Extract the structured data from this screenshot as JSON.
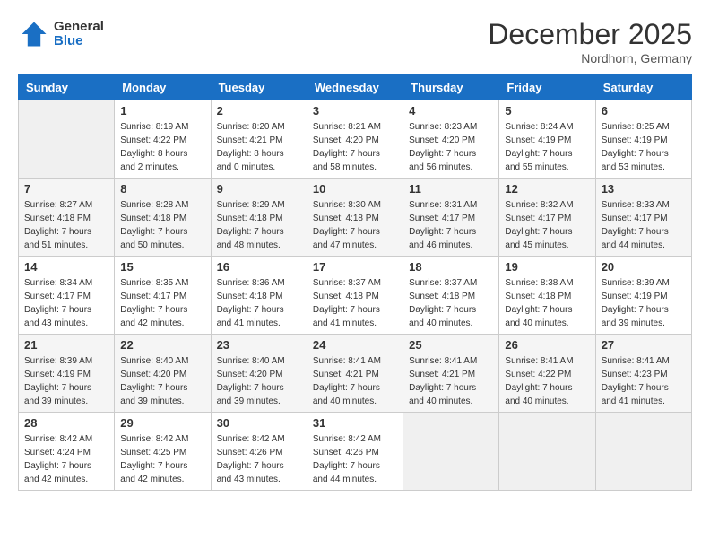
{
  "header": {
    "logo_general": "General",
    "logo_blue": "Blue",
    "month_title": "December 2025",
    "location": "Nordhorn, Germany"
  },
  "days_of_week": [
    "Sunday",
    "Monday",
    "Tuesday",
    "Wednesday",
    "Thursday",
    "Friday",
    "Saturday"
  ],
  "weeks": [
    [
      {
        "day": "",
        "info": ""
      },
      {
        "day": "1",
        "info": "Sunrise: 8:19 AM\nSunset: 4:22 PM\nDaylight: 8 hours\nand 2 minutes."
      },
      {
        "day": "2",
        "info": "Sunrise: 8:20 AM\nSunset: 4:21 PM\nDaylight: 8 hours\nand 0 minutes."
      },
      {
        "day": "3",
        "info": "Sunrise: 8:21 AM\nSunset: 4:20 PM\nDaylight: 7 hours\nand 58 minutes."
      },
      {
        "day": "4",
        "info": "Sunrise: 8:23 AM\nSunset: 4:20 PM\nDaylight: 7 hours\nand 56 minutes."
      },
      {
        "day": "5",
        "info": "Sunrise: 8:24 AM\nSunset: 4:19 PM\nDaylight: 7 hours\nand 55 minutes."
      },
      {
        "day": "6",
        "info": "Sunrise: 8:25 AM\nSunset: 4:19 PM\nDaylight: 7 hours\nand 53 minutes."
      }
    ],
    [
      {
        "day": "7",
        "info": "Sunrise: 8:27 AM\nSunset: 4:18 PM\nDaylight: 7 hours\nand 51 minutes."
      },
      {
        "day": "8",
        "info": "Sunrise: 8:28 AM\nSunset: 4:18 PM\nDaylight: 7 hours\nand 50 minutes."
      },
      {
        "day": "9",
        "info": "Sunrise: 8:29 AM\nSunset: 4:18 PM\nDaylight: 7 hours\nand 48 minutes."
      },
      {
        "day": "10",
        "info": "Sunrise: 8:30 AM\nSunset: 4:18 PM\nDaylight: 7 hours\nand 47 minutes."
      },
      {
        "day": "11",
        "info": "Sunrise: 8:31 AM\nSunset: 4:17 PM\nDaylight: 7 hours\nand 46 minutes."
      },
      {
        "day": "12",
        "info": "Sunrise: 8:32 AM\nSunset: 4:17 PM\nDaylight: 7 hours\nand 45 minutes."
      },
      {
        "day": "13",
        "info": "Sunrise: 8:33 AM\nSunset: 4:17 PM\nDaylight: 7 hours\nand 44 minutes."
      }
    ],
    [
      {
        "day": "14",
        "info": "Sunrise: 8:34 AM\nSunset: 4:17 PM\nDaylight: 7 hours\nand 43 minutes."
      },
      {
        "day": "15",
        "info": "Sunrise: 8:35 AM\nSunset: 4:17 PM\nDaylight: 7 hours\nand 42 minutes."
      },
      {
        "day": "16",
        "info": "Sunrise: 8:36 AM\nSunset: 4:18 PM\nDaylight: 7 hours\nand 41 minutes."
      },
      {
        "day": "17",
        "info": "Sunrise: 8:37 AM\nSunset: 4:18 PM\nDaylight: 7 hours\nand 41 minutes."
      },
      {
        "day": "18",
        "info": "Sunrise: 8:37 AM\nSunset: 4:18 PM\nDaylight: 7 hours\nand 40 minutes."
      },
      {
        "day": "19",
        "info": "Sunrise: 8:38 AM\nSunset: 4:18 PM\nDaylight: 7 hours\nand 40 minutes."
      },
      {
        "day": "20",
        "info": "Sunrise: 8:39 AM\nSunset: 4:19 PM\nDaylight: 7 hours\nand 39 minutes."
      }
    ],
    [
      {
        "day": "21",
        "info": "Sunrise: 8:39 AM\nSunset: 4:19 PM\nDaylight: 7 hours\nand 39 minutes."
      },
      {
        "day": "22",
        "info": "Sunrise: 8:40 AM\nSunset: 4:20 PM\nDaylight: 7 hours\nand 39 minutes."
      },
      {
        "day": "23",
        "info": "Sunrise: 8:40 AM\nSunset: 4:20 PM\nDaylight: 7 hours\nand 39 minutes."
      },
      {
        "day": "24",
        "info": "Sunrise: 8:41 AM\nSunset: 4:21 PM\nDaylight: 7 hours\nand 40 minutes."
      },
      {
        "day": "25",
        "info": "Sunrise: 8:41 AM\nSunset: 4:21 PM\nDaylight: 7 hours\nand 40 minutes."
      },
      {
        "day": "26",
        "info": "Sunrise: 8:41 AM\nSunset: 4:22 PM\nDaylight: 7 hours\nand 40 minutes."
      },
      {
        "day": "27",
        "info": "Sunrise: 8:41 AM\nSunset: 4:23 PM\nDaylight: 7 hours\nand 41 minutes."
      }
    ],
    [
      {
        "day": "28",
        "info": "Sunrise: 8:42 AM\nSunset: 4:24 PM\nDaylight: 7 hours\nand 42 minutes."
      },
      {
        "day": "29",
        "info": "Sunrise: 8:42 AM\nSunset: 4:25 PM\nDaylight: 7 hours\nand 42 minutes."
      },
      {
        "day": "30",
        "info": "Sunrise: 8:42 AM\nSunset: 4:26 PM\nDaylight: 7 hours\nand 43 minutes."
      },
      {
        "day": "31",
        "info": "Sunrise: 8:42 AM\nSunset: 4:26 PM\nDaylight: 7 hours\nand 44 minutes."
      },
      {
        "day": "",
        "info": ""
      },
      {
        "day": "",
        "info": ""
      },
      {
        "day": "",
        "info": ""
      }
    ]
  ]
}
